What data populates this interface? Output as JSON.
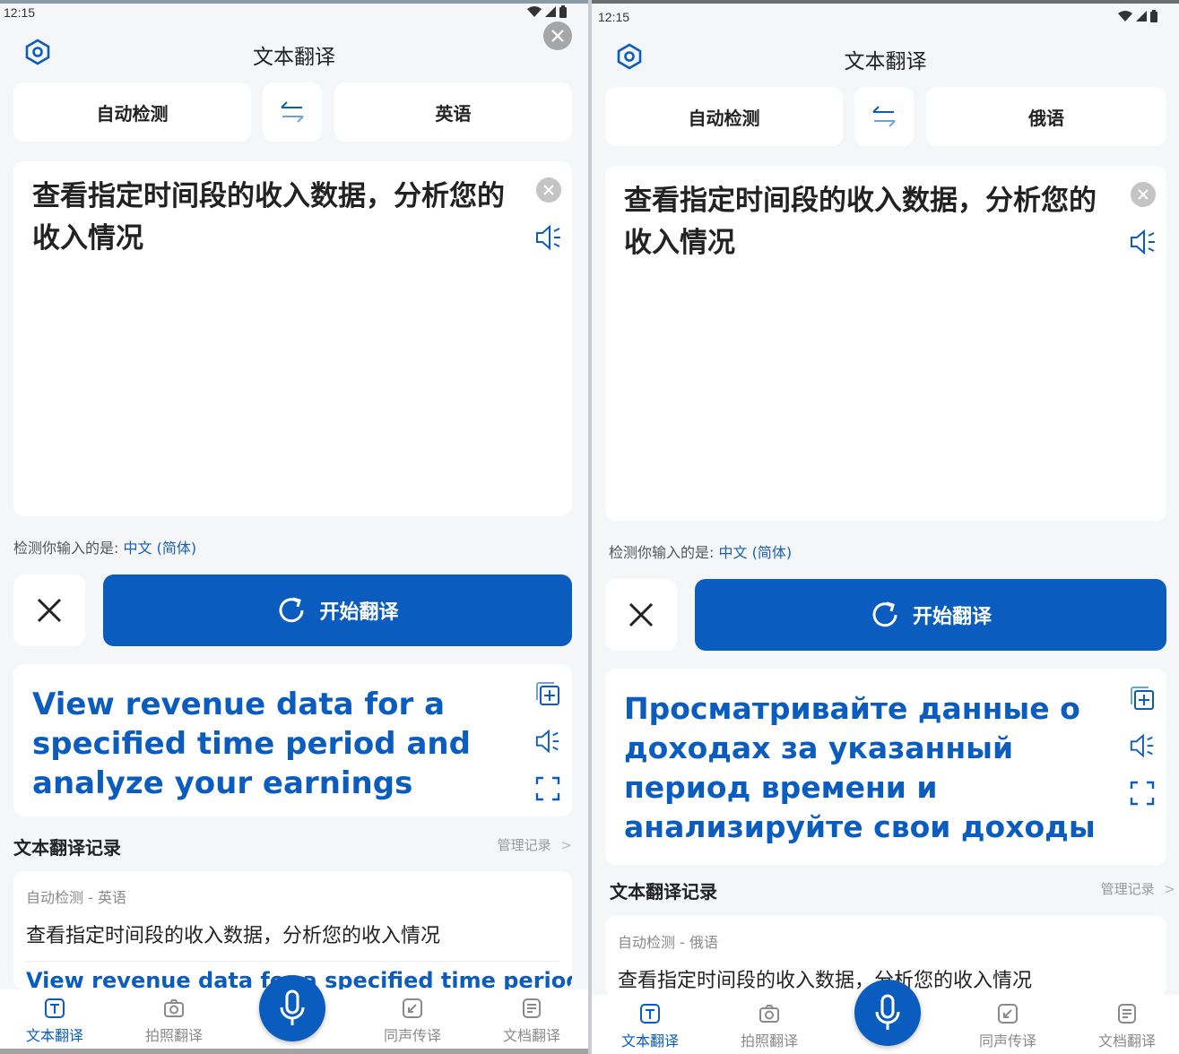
{
  "colors": {
    "accent": "#0b5cbf",
    "background": "#f5f6f8",
    "card": "#ffffff"
  },
  "panels": [
    {
      "status": {
        "time": "12:15"
      },
      "header": {
        "title": "文本翻译"
      },
      "langs": {
        "from": "自动检测",
        "to": "英语"
      },
      "input": {
        "text": "查看指定时间段的收入数据，分析您的收入情况"
      },
      "detect": {
        "label": "检测你输入的是:",
        "lang": "中文 (简体)"
      },
      "action": {
        "go_label": "开始翻译"
      },
      "result": {
        "text": "View revenue data for a specified time period and analyze your earnings"
      },
      "history": {
        "title": "文本翻译记录",
        "manage": "管理记录",
        "item": {
          "meta": "自动检测 - 英语",
          "source": "查看指定时间段的收入数据，分析您的收入情况",
          "translation": "View revenue data for a specified time period a"
        }
      },
      "nav": {
        "text": "文本翻译",
        "photo": "拍照翻译",
        "voice": "同声传译",
        "doc": "文档翻译"
      }
    },
    {
      "status": {
        "time": "12:15"
      },
      "header": {
        "title": "文本翻译"
      },
      "langs": {
        "from": "自动检测",
        "to": "俄语"
      },
      "input": {
        "text": "查看指定时间段的收入数据，分析您的收入情况"
      },
      "detect": {
        "label": "检测你输入的是:",
        "lang": "中文 (简体)"
      },
      "action": {
        "go_label": "开始翻译"
      },
      "result": {
        "text": "Просматривайте данные о доходах за указанный период времени и анализируйте свои доходы"
      },
      "history": {
        "title": "文本翻译记录",
        "manage": "管理记录",
        "item": {
          "meta": "自动检测 - 俄语",
          "source": "查看指定时间段的收入数据，分析您的收入情况"
        }
      },
      "nav": {
        "text": "文本翻译",
        "photo": "拍照翻译",
        "voice": "同声传译",
        "doc": "文档翻译"
      }
    }
  ]
}
